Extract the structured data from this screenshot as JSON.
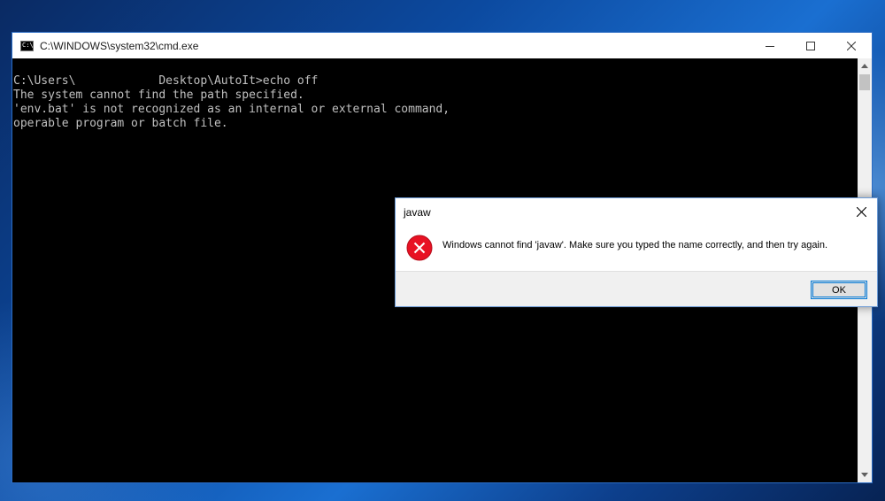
{
  "cmd_window": {
    "title": "C:\\WINDOWS\\system32\\cmd.exe",
    "icon": "console-app-icon",
    "controls": [
      "minimize-icon",
      "maximize-icon",
      "close-icon"
    ],
    "console_lines": [
      "C:\\Users\\            Desktop\\AutoIt>echo off",
      "The system cannot find the path specified.",
      "'env.bat' is not recognized as an internal or external command,",
      "operable program or batch file."
    ]
  },
  "error_dialog": {
    "title": "javaw",
    "icon": "error-icon",
    "message": "Windows cannot find 'javaw'. Make sure you typed the name correctly, and then try again.",
    "ok_label": "OK",
    "colors": {
      "error_red": "#e81123",
      "focus_blue": "#0078d7"
    }
  }
}
